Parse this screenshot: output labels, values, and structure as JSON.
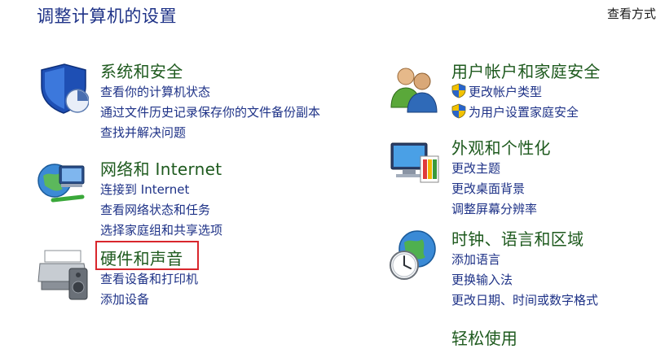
{
  "header": {
    "title": "调整计算机的设置",
    "view_by": "查看方式"
  },
  "categories": {
    "system": {
      "title": "系统和安全",
      "icon": "security-shield-icon",
      "links": [
        "查看你的计算机状态",
        "通过文件历史记录保存你的文件备份副本",
        "查找并解决问题"
      ]
    },
    "network": {
      "title": "网络和 Internet",
      "icon": "network-globe-icon",
      "links": [
        "连接到 Internet",
        "查看网络状态和任务",
        "选择家庭组和共享选项"
      ]
    },
    "hardware": {
      "title": "硬件和声音",
      "icon": "printer-speaker-icon",
      "links": [
        "查看设备和打印机",
        "添加设备"
      ]
    },
    "users": {
      "title": "用户帐户和家庭安全",
      "icon": "users-icon",
      "links": [
        "更改帐户类型",
        "为用户设置家庭安全"
      ]
    },
    "appearance": {
      "title": "外观和个性化",
      "icon": "monitor-palette-icon",
      "links": [
        "更改主题",
        "更改桌面背景",
        "调整屏幕分辨率"
      ]
    },
    "clock": {
      "title": "时钟、语言和区域",
      "icon": "clock-globe-icon",
      "links": [
        "添加语言",
        "更换输入法",
        "更改日期、时间或数字格式"
      ]
    },
    "ease": {
      "title": "轻松使用"
    }
  },
  "colors": {
    "category_title": "#1e5a1e",
    "link": "#1e3287",
    "highlight": "#d9262c"
  }
}
